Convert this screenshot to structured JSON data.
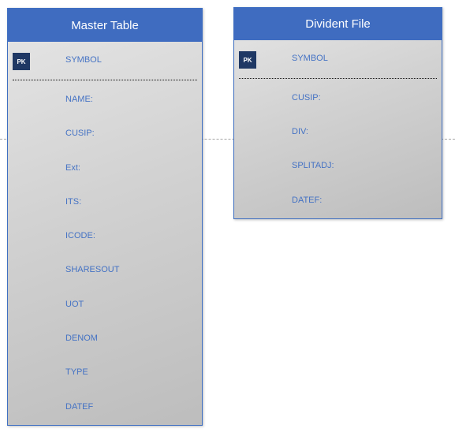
{
  "master_table": {
    "title": "Master Table",
    "pk_badge": "PK",
    "key_field": "SYMBOL",
    "fields": [
      "NAME:",
      "CUSIP:",
      "Ext:",
      "ITS:",
      "ICODE:",
      "SHARESOUT",
      "UOT",
      "DENOM",
      "TYPE",
      "DATEF"
    ]
  },
  "divident_file": {
    "title": "Divident File",
    "pk_badge": "PK",
    "key_field": "SYMBOL",
    "fields": [
      "CUSIP:",
      "DIV:",
      "SPLITADJ:",
      "DATEF:"
    ]
  },
  "colors": {
    "header": "#3f6cc0",
    "field_text": "#4472c4",
    "pk_badge": "#1f3864",
    "body_gradient_light": "#e6e6e6",
    "body_gradient_dark": "#bdbdbd"
  }
}
